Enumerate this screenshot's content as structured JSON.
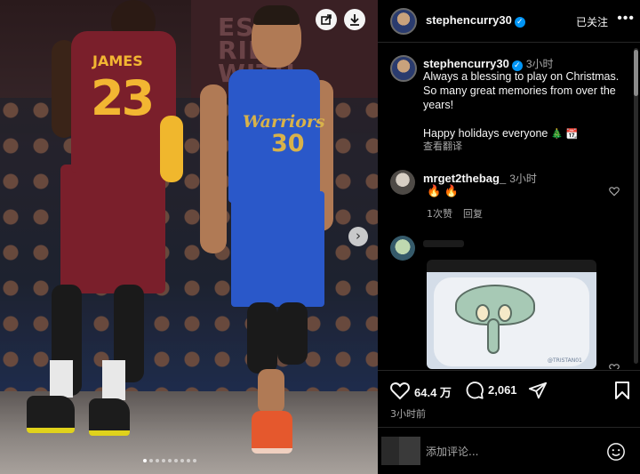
{
  "photo": {
    "banner_text": "ES\nRIES\nWITH",
    "jersey_left": {
      "name": "JAMES",
      "number": "23"
    },
    "jersey_right": {
      "team": "Warriors",
      "number": "30"
    },
    "share_icon": "share-icon",
    "download_icon": "download-icon",
    "next_icon": "chevron-right-icon",
    "carousel": {
      "count": 9,
      "active": 0
    }
  },
  "header": {
    "username": "stephencurry30",
    "verified_icon": "verified-badge-icon",
    "follow_label": "已关注",
    "more_icon": "more-icon"
  },
  "post": {
    "username": "stephencurry30",
    "time": "3小时",
    "caption_lines": [
      "Always a blessing to play on Christmas. So many great memories from over the years!",
      "Happy holidays everyone"
    ],
    "caption_emoji": "🎄 📆",
    "translate_label": "查看翻译"
  },
  "comments": [
    {
      "username": "mrget2thebag_",
      "time": "3小时",
      "text": "🔥 🔥",
      "likes_label": "1次赞",
      "reply_label": "回复"
    },
    {
      "username": "",
      "gif_watermark": "@TRISTAN01"
    }
  ],
  "actions": {
    "like_icon": "heart-icon",
    "likes_count": "64.4 万",
    "comment_icon": "comment-icon",
    "comments_count": "2,061",
    "share_icon": "send-icon",
    "save_icon": "bookmark-icon",
    "posted_time": "3小时前"
  },
  "composer": {
    "placeholder": "添加评论...",
    "emoji_icon": "smile-icon"
  },
  "colors": {
    "background": "#000000",
    "verified": "#0095f6",
    "secondary_text": "#a8a8a8",
    "divider": "#262626"
  }
}
